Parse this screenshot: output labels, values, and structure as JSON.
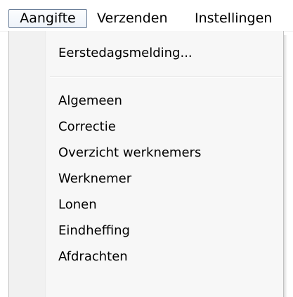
{
  "menubar": {
    "items": [
      {
        "label": "Aangifte"
      },
      {
        "label": "Verzenden"
      },
      {
        "label": "Instellingen"
      }
    ]
  },
  "dropdown": {
    "items": [
      {
        "label": "Eerstedagsmelding..."
      },
      {
        "label": "Algemeen"
      },
      {
        "label": "Correctie"
      },
      {
        "label": "Overzicht werknemers"
      },
      {
        "label": "Werknemer"
      },
      {
        "label": "Lonen"
      },
      {
        "label": "Eindheffing"
      },
      {
        "label": "Afdrachten"
      }
    ]
  }
}
